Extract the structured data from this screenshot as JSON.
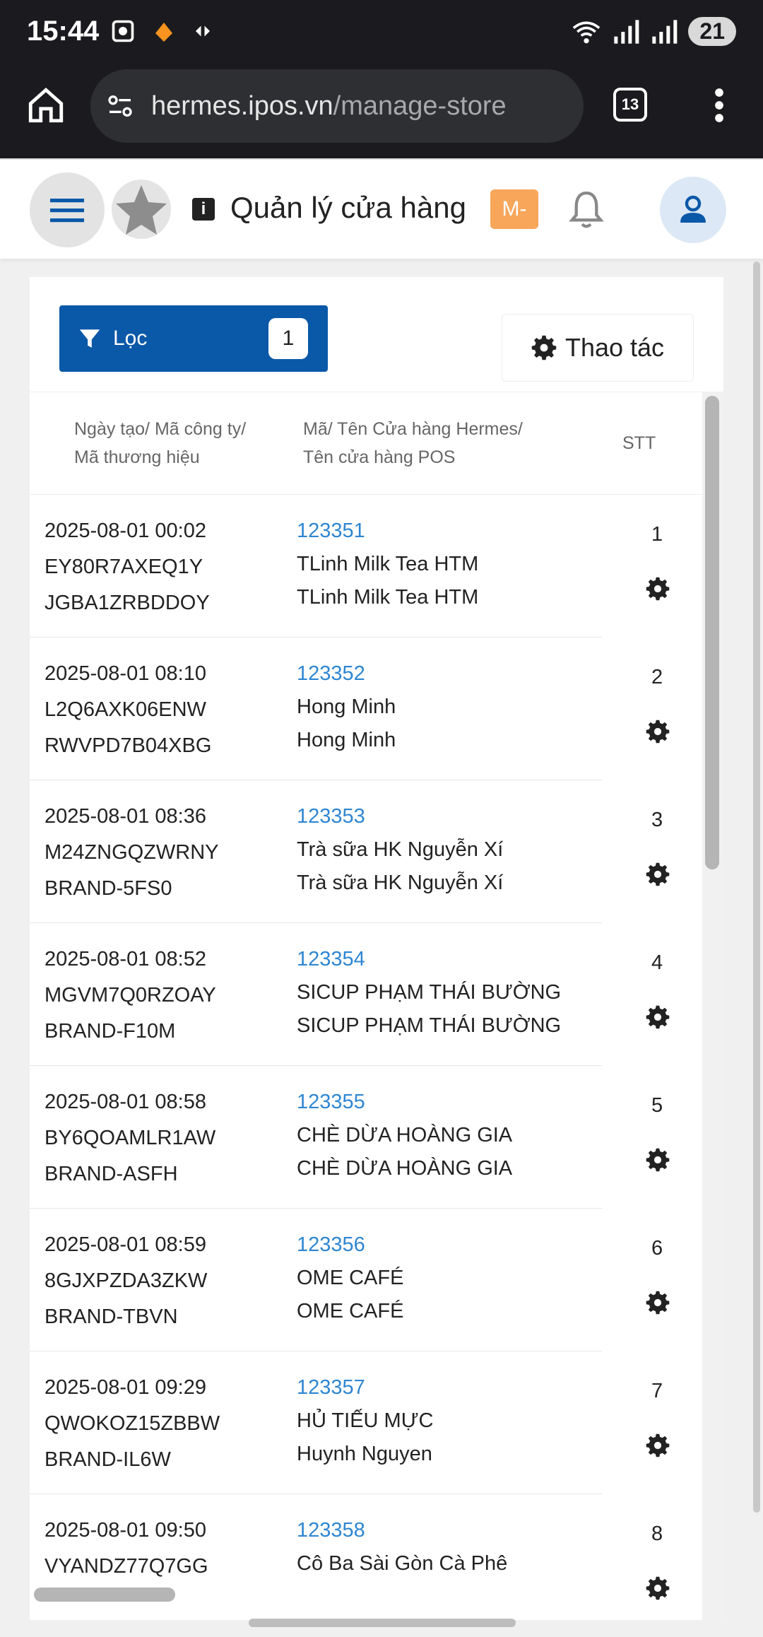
{
  "statusbar": {
    "time": "15:44",
    "battery": "21"
  },
  "browser": {
    "url_host": "hermes.ipos.vn",
    "url_path": "/manage-store",
    "tab_count": "13"
  },
  "header": {
    "title": "Quản lý cửa hàng",
    "badge": "M-"
  },
  "toolbar": {
    "filter_label": "Lọc",
    "filter_count": "1",
    "action_label": "Thao tác"
  },
  "table": {
    "headers": {
      "col1_line1": "Ngày tạo/ Mã công ty/",
      "col1_line2": "Mã thương hiệu",
      "col2_line1": "Mã/ Tên Cửa hàng Hermes/",
      "col2_line2": "Tên cửa hàng POS",
      "col3": "STT"
    },
    "rows": [
      {
        "date": "2025-08-01 00:02",
        "company": "EY80R7AXEQ1Y",
        "brand": "JGBA1ZRBDDOY",
        "code": "123351",
        "name_hermes": "TLinh Milk Tea HTM",
        "name_pos": "TLinh Milk Tea HTM",
        "stt": "1"
      },
      {
        "date": "2025-08-01 08:10",
        "company": "L2Q6AXK06ENW",
        "brand": "RWVPD7B04XBG",
        "code": "123352",
        "name_hermes": "Hong Minh",
        "name_pos": "Hong Minh",
        "stt": "2"
      },
      {
        "date": "2025-08-01 08:36",
        "company": "M24ZNGQZWRNY",
        "brand": "BRAND-5FS0",
        "code": "123353",
        "name_hermes": "Trà sữa HK Nguyễn Xí",
        "name_pos": "Trà sữa HK Nguyễn Xí",
        "stt": "3"
      },
      {
        "date": "2025-08-01 08:52",
        "company": "MGVM7Q0RZOAY",
        "brand": "BRAND-F10M",
        "code": "123354",
        "name_hermes": "SICUP PHẠM THÁI BƯỜNG",
        "name_pos": "SICUP PHẠM THÁI BƯỜNG",
        "stt": "4"
      },
      {
        "date": "2025-08-01 08:58",
        "company": "BY6QOAMLR1AW",
        "brand": "BRAND-ASFH",
        "code": "123355",
        "name_hermes": "CHÈ DỪA HOÀNG GIA",
        "name_pos": "CHÈ DỪA HOÀNG GIA",
        "stt": "5"
      },
      {
        "date": "2025-08-01 08:59",
        "company": "8GJXPZDA3ZKW",
        "brand": "BRAND-TBVN",
        "code": "123356",
        "name_hermes": "OME CAFÉ",
        "name_pos": "OME CAFÉ",
        "stt": "6"
      },
      {
        "date": "2025-08-01 09:29",
        "company": "QWOKOZ15ZBBW",
        "brand": "BRAND-IL6W",
        "code": "123357",
        "name_hermes": "HỦ TIẾU MỰC",
        "name_pos": "Huynh Nguyen",
        "stt": "7"
      },
      {
        "date": "2025-08-01 09:50",
        "company": "VYANDZ77Q7GG",
        "brand": "",
        "code": "123358",
        "name_hermes": "Cô Ba Sài Gòn Cà Phê",
        "name_pos": "",
        "stt": "8"
      }
    ]
  },
  "icons": {
    "home": "home-icon",
    "site_settings": "site-settings-icon",
    "menu": "hamburger-icon",
    "logo": "star-logo-icon",
    "info": "info-icon",
    "bell": "bell-icon",
    "user": "user-icon",
    "filter": "filter-icon",
    "gear": "gear-icon",
    "more": "more-vert-icon"
  },
  "colors": {
    "primary": "#0a58a8",
    "link": "#2f86d1",
    "badge": "#f7a65a"
  }
}
